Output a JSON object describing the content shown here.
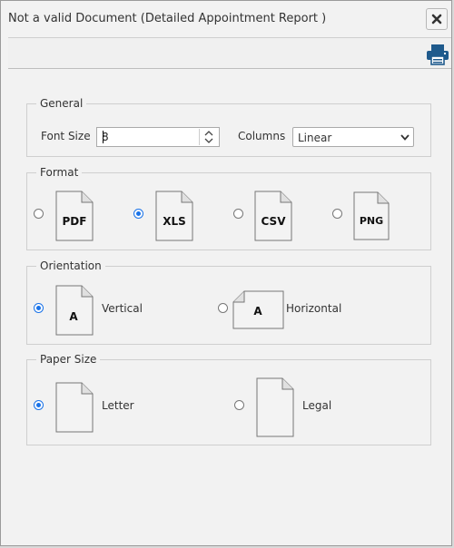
{
  "dialog": {
    "title": "Not a valid Document (Detailed Appointment Report )"
  },
  "icons": {
    "close": "close-icon",
    "print": "print-icon"
  },
  "general": {
    "legend": "General",
    "font_size_label": "Font Size",
    "font_size_value": "8",
    "columns_label": "Columns",
    "columns_value": "Linear"
  },
  "format": {
    "legend": "Format",
    "options": [
      {
        "label": "PDF",
        "selected": false
      },
      {
        "label": "XLS",
        "selected": true
      },
      {
        "label": "CSV",
        "selected": false
      },
      {
        "label": "PNG",
        "selected": false
      }
    ]
  },
  "orientation": {
    "legend": "Orientation",
    "icon_letter": "A",
    "options": [
      {
        "label": "Vertical",
        "selected": true
      },
      {
        "label": "Horizontal",
        "selected": false
      }
    ]
  },
  "paper": {
    "legend": "Paper Size",
    "options": [
      {
        "label": "Letter",
        "selected": true
      },
      {
        "label": "Legal",
        "selected": false
      }
    ]
  },
  "colors": {
    "accent": "#1a73e8",
    "print_icon": "#1f5a8c"
  }
}
